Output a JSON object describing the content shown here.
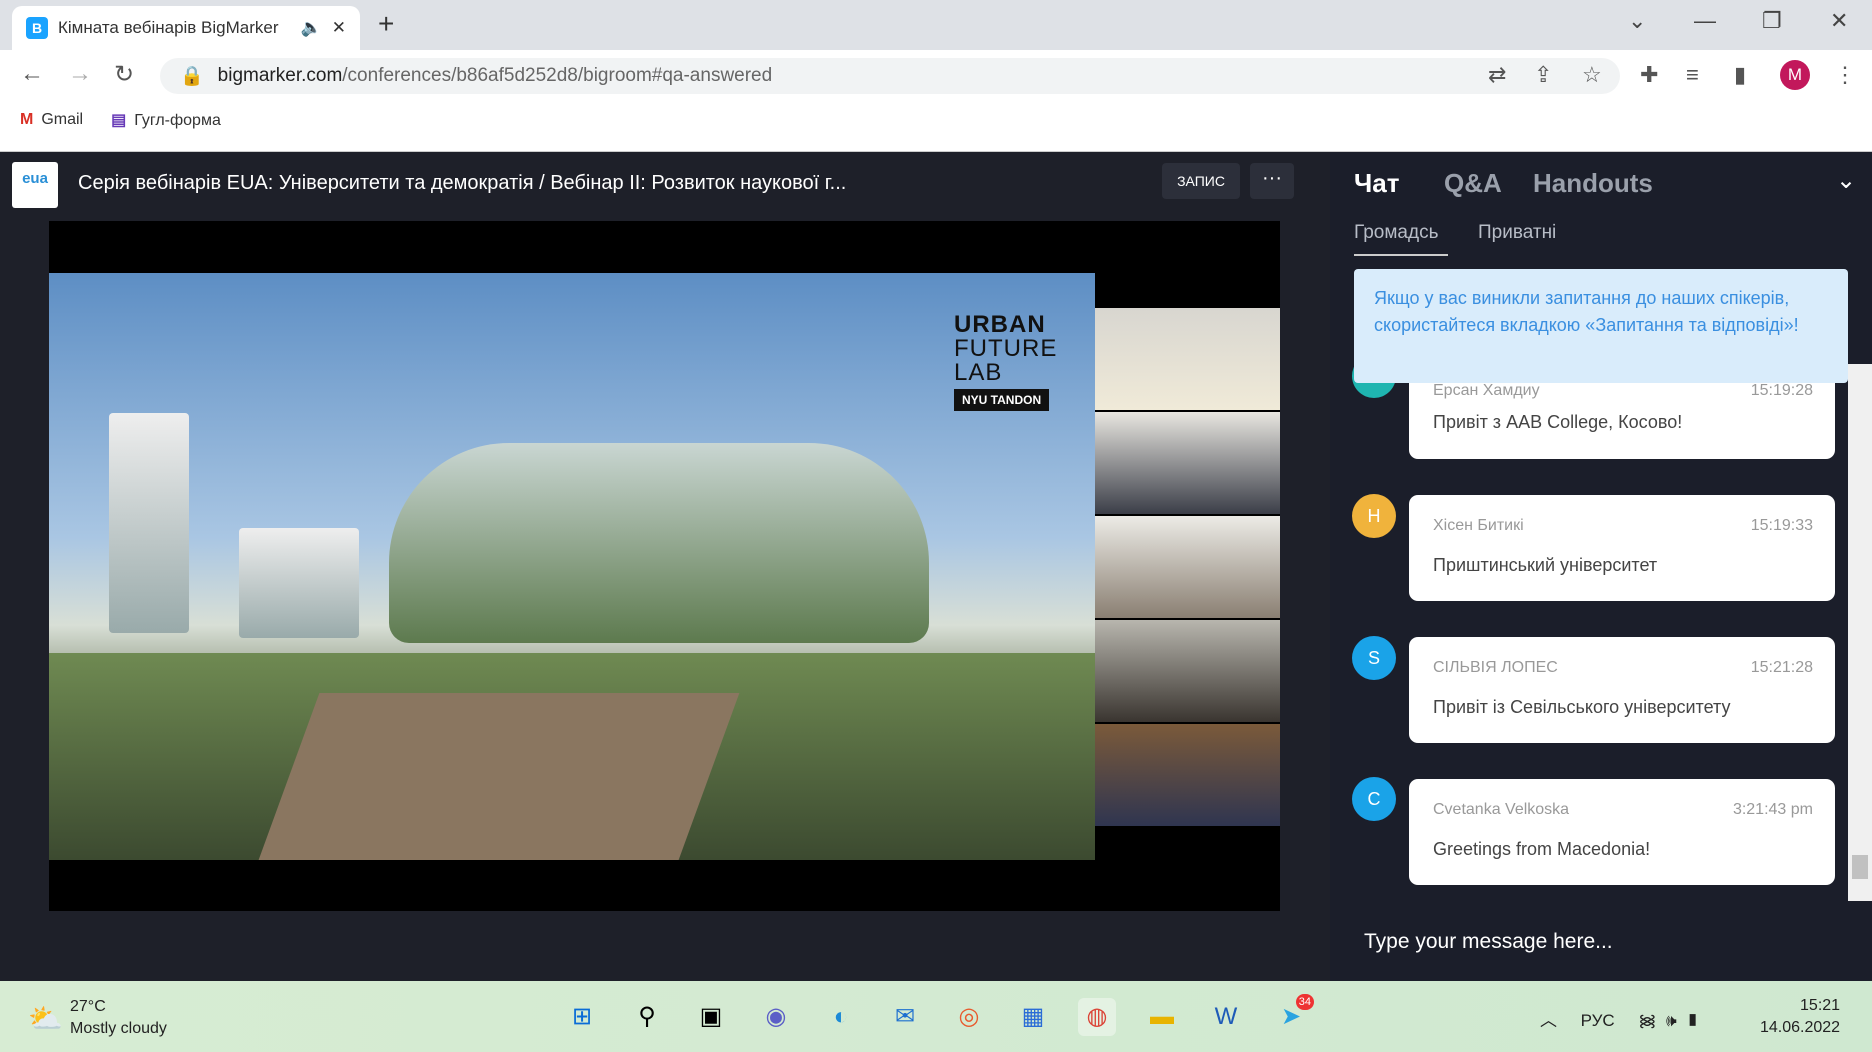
{
  "browser": {
    "tab_title": "Кімната вебінарів BigMarker",
    "url_host": "bigmarker.com",
    "url_path": "/conferences/b86af5d252d8/bigroom#qa-answered",
    "profile_initial": "M",
    "bookmarks": [
      "Gmail",
      "Гугл-форма"
    ]
  },
  "webinar": {
    "logo_text": "eua",
    "title": "Серія вебінарів EUA: Університети та демократія / Вебінар II: Розвиток наукової г...",
    "record_label": "ЗАПИС",
    "more_label": "···",
    "slide_title_lines": [
      "URBAN",
      "FUTURE",
      "LAB"
    ],
    "slide_badge": "NYU TANDON"
  },
  "chat": {
    "tabs": [
      "Чат",
      "Q&A",
      "Handouts"
    ],
    "subtabs": [
      "Громадсь",
      "Приватні"
    ],
    "notice": "Якщо у вас виникли запитання до наших спікерів, скористайтеся вкладкою «Запитання та відповіді»!",
    "messages": [
      {
        "initial": "",
        "name": "Ерсан Хамдиу",
        "time": "15:19:28",
        "text": "Привіт з AAB College, Косово!",
        "color": "#1fb5b0"
      },
      {
        "initial": "H",
        "name": "Хісен Битикі",
        "time": "15:19:33",
        "text": "Приштинський університет",
        "color": "#f0b33c"
      },
      {
        "initial": "S",
        "name": "СІЛЬВІЯ ЛОПЕС",
        "time": "15:21:28",
        "text": "Привіт із Севільського університету",
        "color": "#1aa3e8"
      },
      {
        "initial": "C",
        "name": "Cvetanka Velkoska",
        "time": "3:21:43 pm",
        "text": "Greetings from Macedonia!",
        "color": "#1aa3e8"
      }
    ],
    "input_placeholder": "Type your message here..."
  },
  "taskbar": {
    "temp": "27°C",
    "weather": "Mostly cloudy",
    "lang": "РУС",
    "time": "15:21",
    "date": "14.06.2022",
    "telegram_badge": "34"
  }
}
